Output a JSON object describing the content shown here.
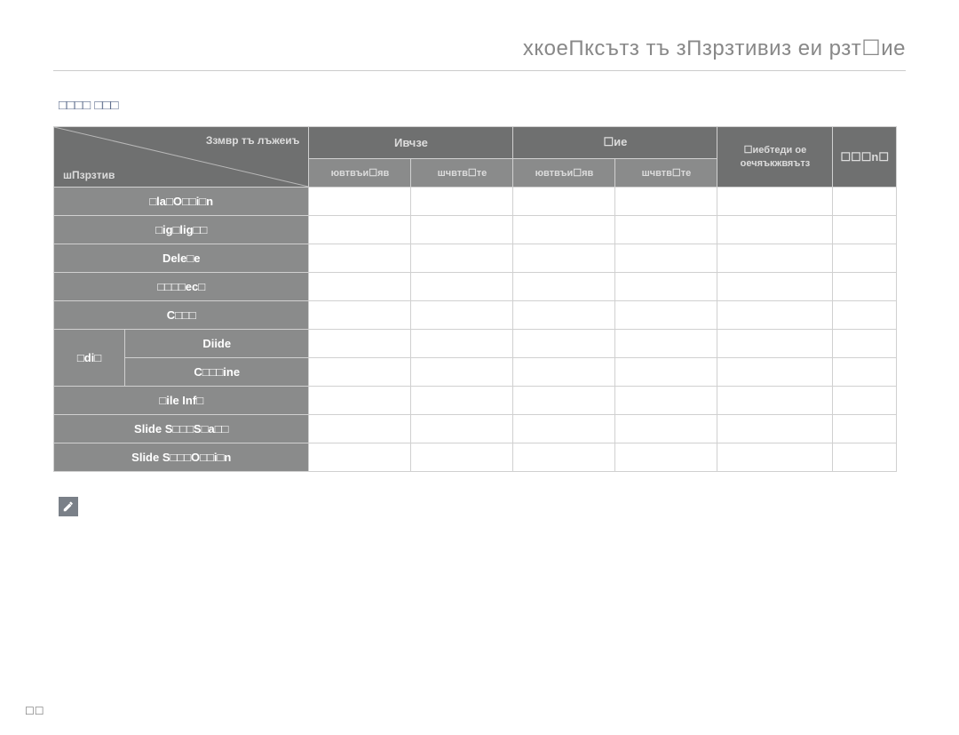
{
  "chapter_title": "хкоеПксътз тъ зПзрзтивиз еи рзт☐ие",
  "section_title": "□□□□ □□□",
  "table": {
    "diag_top": "Ззмвр тъ\nлъжеиъ",
    "diag_bottom": "шПзрзтив",
    "hdr_image": "Ивчзе",
    "hdr_movie": "☐ие",
    "hdr_background": "☐иебтеди ое\nоечяъкжвяътз",
    "hdr_other": "☐☐☐n☐",
    "sub_thumb1": "ювтвъи☐яв",
    "sub_separate1": "шчвтв☐те",
    "sub_thumb2": "ювтвъи☐яв",
    "sub_separate2": "шчвтв☐те",
    "rows": [
      {
        "label": "□la□O□□i□n"
      },
      {
        "label": "□ig□lig□□"
      },
      {
        "label": "Dele□e"
      },
      {
        "label": "□□□□ec□"
      },
      {
        "label": "C□□□"
      }
    ],
    "edit_label": "□di□",
    "edit_sub": [
      {
        "label": "Diide"
      },
      {
        "label": "C□□□ine"
      }
    ],
    "rows2": [
      {
        "label": "□ile Inf□"
      },
      {
        "label": "Slide S□□□S□a□□"
      },
      {
        "label": "Slide S□□□O□□i□n"
      }
    ]
  },
  "note_text": "",
  "page_number": "☐☐"
}
